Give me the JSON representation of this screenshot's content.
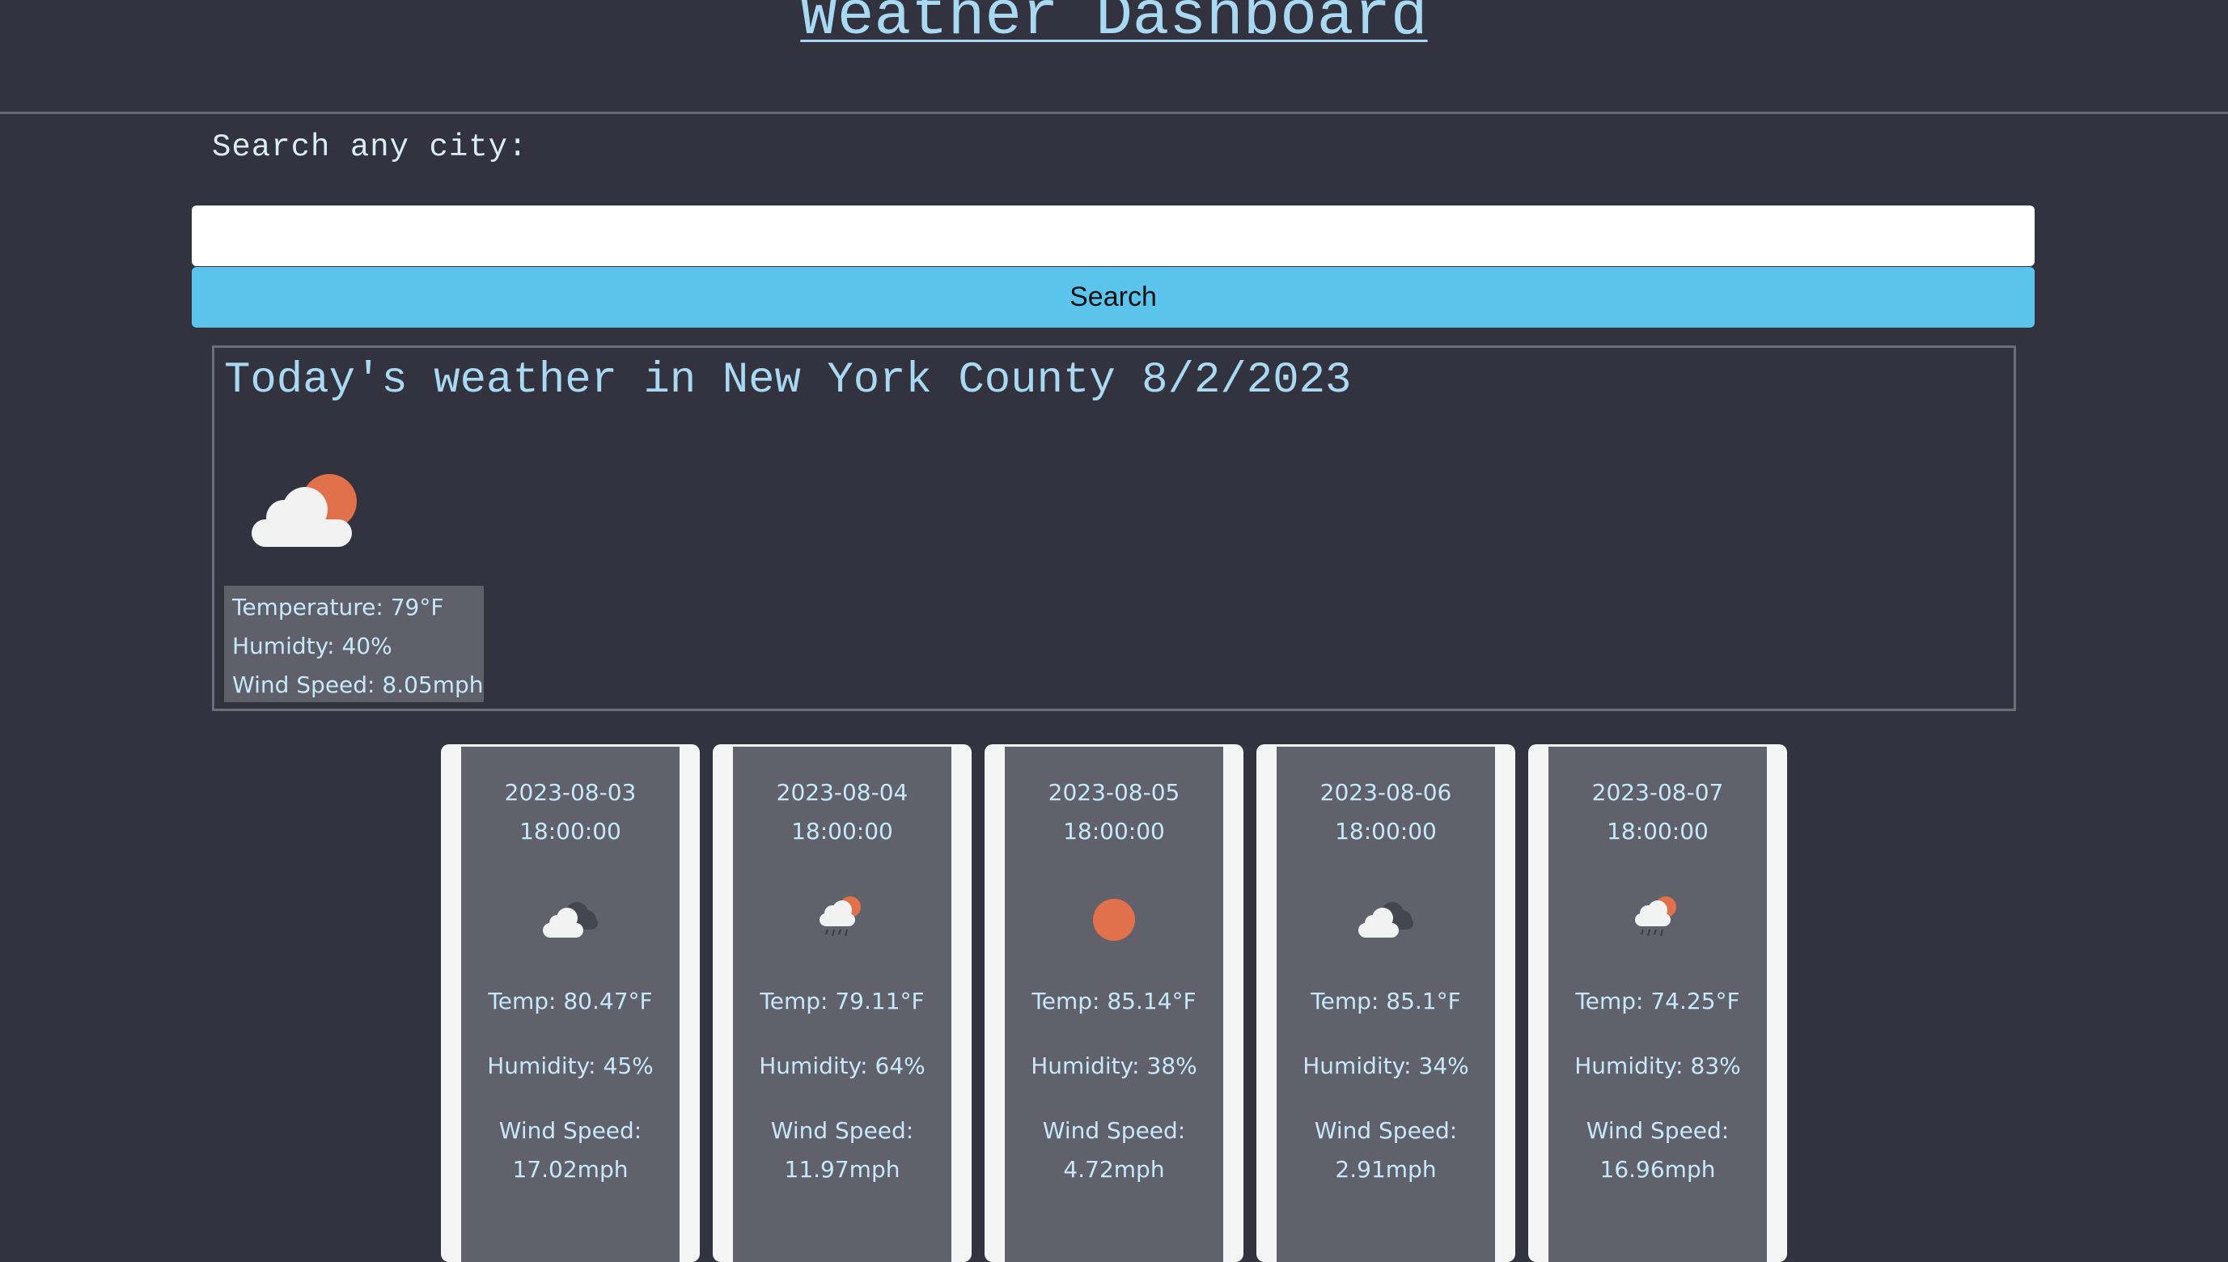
{
  "header": {
    "title": "Weather Dashboard"
  },
  "search": {
    "label": "Search any city:",
    "value": "",
    "placeholder": "",
    "button_label": "Search"
  },
  "today": {
    "title": "Today's weather in New York County 8/2/2023",
    "icon": "cloud-sun-icon",
    "temperature": "Temperature: 79°F",
    "humidity": "Humidty: 40%",
    "wind": "Wind Speed: 8.05mph"
  },
  "forecast": [
    {
      "date": "2023-08-03",
      "time": "18:00:00",
      "icon": "dark-cloud-icon",
      "temp": "Temp: 80.47°F",
      "humidity": "Humidity: 45%",
      "wind_label": "Wind Speed:",
      "wind_value": "17.02mph"
    },
    {
      "date": "2023-08-04",
      "time": "18:00:00",
      "icon": "rain-cloud-sun-icon",
      "temp": "Temp: 79.11°F",
      "humidity": "Humidity: 64%",
      "wind_label": "Wind Speed:",
      "wind_value": "11.97mph"
    },
    {
      "date": "2023-08-05",
      "time": "18:00:00",
      "icon": "sun-icon",
      "temp": "Temp: 85.14°F",
      "humidity": "Humidity: 38%",
      "wind_label": "Wind Speed:",
      "wind_value": "4.72mph"
    },
    {
      "date": "2023-08-06",
      "time": "18:00:00",
      "icon": "dark-cloud-icon",
      "temp": "Temp: 85.1°F",
      "humidity": "Humidity: 34%",
      "wind_label": "Wind Speed:",
      "wind_value": "2.91mph"
    },
    {
      "date": "2023-08-07",
      "time": "18:00:00",
      "icon": "rain-cloud-sun-icon",
      "temp": "Temp: 74.25°F",
      "humidity": "Humidity: 83%",
      "wind_label": "Wind Speed:",
      "wind_value": "16.96mph"
    }
  ],
  "colors": {
    "background": "#32333f",
    "accent_text": "#a9d8f3",
    "search_button": "#5bc4ed",
    "sun": "#e0714b",
    "cloud": "#f2f2f2"
  }
}
